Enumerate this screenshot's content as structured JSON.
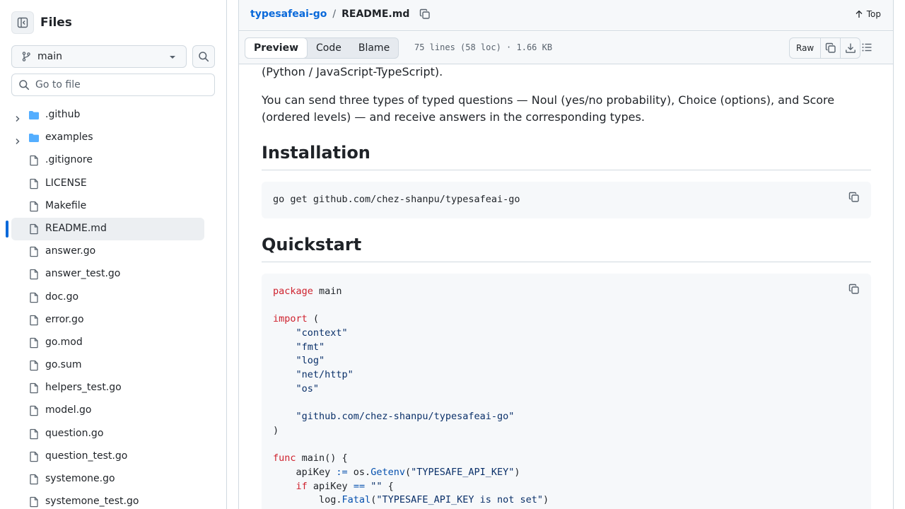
{
  "sidebar": {
    "title": "Files",
    "branch": "main",
    "goto_placeholder": "Go to file",
    "items": [
      {
        "name": ".github",
        "type": "folder"
      },
      {
        "name": "examples",
        "type": "folder"
      },
      {
        "name": ".gitignore",
        "type": "file"
      },
      {
        "name": "LICENSE",
        "type": "file"
      },
      {
        "name": "Makefile",
        "type": "file"
      },
      {
        "name": "README.md",
        "type": "file",
        "active": true
      },
      {
        "name": "answer.go",
        "type": "file"
      },
      {
        "name": "answer_test.go",
        "type": "file"
      },
      {
        "name": "doc.go",
        "type": "file"
      },
      {
        "name": "error.go",
        "type": "file"
      },
      {
        "name": "go.mod",
        "type": "file"
      },
      {
        "name": "go.sum",
        "type": "file"
      },
      {
        "name": "helpers_test.go",
        "type": "file"
      },
      {
        "name": "model.go",
        "type": "file"
      },
      {
        "name": "question.go",
        "type": "file"
      },
      {
        "name": "question_test.go",
        "type": "file"
      },
      {
        "name": "systemone.go",
        "type": "file"
      },
      {
        "name": "systemone_test.go",
        "type": "file"
      }
    ]
  },
  "header": {
    "repo": "typesafeai-go",
    "separator": "/",
    "file": "README.md",
    "top_label": "Top"
  },
  "toolbar": {
    "tabs": [
      "Preview",
      "Code",
      "Blame"
    ],
    "active_tab": "Preview",
    "meta": "75 lines (58 loc) · 1.66 KB",
    "raw_label": "Raw"
  },
  "readme": {
    "para_tail": "(Python / JavaScript-TypeScript).",
    "para_1": "You can send three types of typed questions — Noul (yes/no probability), Choice (options), and Score",
    "para_2": "(ordered levels) — and receive answers in the corresponding types.",
    "h_install": "Installation",
    "install_cmd": "go get github.com/chez-shanpu/typesafeai-go",
    "h_quickstart": "Quickstart"
  },
  "code_lines": [
    [
      {
        "t": "package",
        "c": "kw"
      },
      {
        "t": " main"
      }
    ],
    [],
    [
      {
        "t": "import",
        "c": "kw"
      },
      {
        "t": " ("
      }
    ],
    [
      {
        "t": "    "
      },
      {
        "t": "\"context\"",
        "c": "str"
      }
    ],
    [
      {
        "t": "    "
      },
      {
        "t": "\"fmt\"",
        "c": "str"
      }
    ],
    [
      {
        "t": "    "
      },
      {
        "t": "\"log\"",
        "c": "str"
      }
    ],
    [
      {
        "t": "    "
      },
      {
        "t": "\"net/http\"",
        "c": "str"
      }
    ],
    [
      {
        "t": "    "
      },
      {
        "t": "\"os\"",
        "c": "str"
      }
    ],
    [],
    [
      {
        "t": "    "
      },
      {
        "t": "\"github.com/chez-shanpu/typesafeai-go\"",
        "c": "str"
      }
    ],
    [
      {
        "t": ")"
      }
    ],
    [],
    [
      {
        "t": "func",
        "c": "kw"
      },
      {
        "t": " main() {"
      }
    ],
    [
      {
        "t": "    apiKey "
      },
      {
        "t": ":=",
        "c": "op"
      },
      {
        "t": " os."
      },
      {
        "t": "Getenv",
        "c": "fn"
      },
      {
        "t": "("
      },
      {
        "t": "\"TYPESAFE_API_KEY\"",
        "c": "str"
      },
      {
        "t": ")"
      }
    ],
    [
      {
        "t": "    "
      },
      {
        "t": "if",
        "c": "kw"
      },
      {
        "t": " apiKey "
      },
      {
        "t": "==",
        "c": "op"
      },
      {
        "t": " "
      },
      {
        "t": "\"\"",
        "c": "str"
      },
      {
        "t": " {"
      }
    ],
    [
      {
        "t": "        log."
      },
      {
        "t": "Fatal",
        "c": "fn"
      },
      {
        "t": "("
      },
      {
        "t": "\"TYPESAFE_API_KEY is not set\"",
        "c": "str"
      },
      {
        "t": ")"
      }
    ]
  ]
}
